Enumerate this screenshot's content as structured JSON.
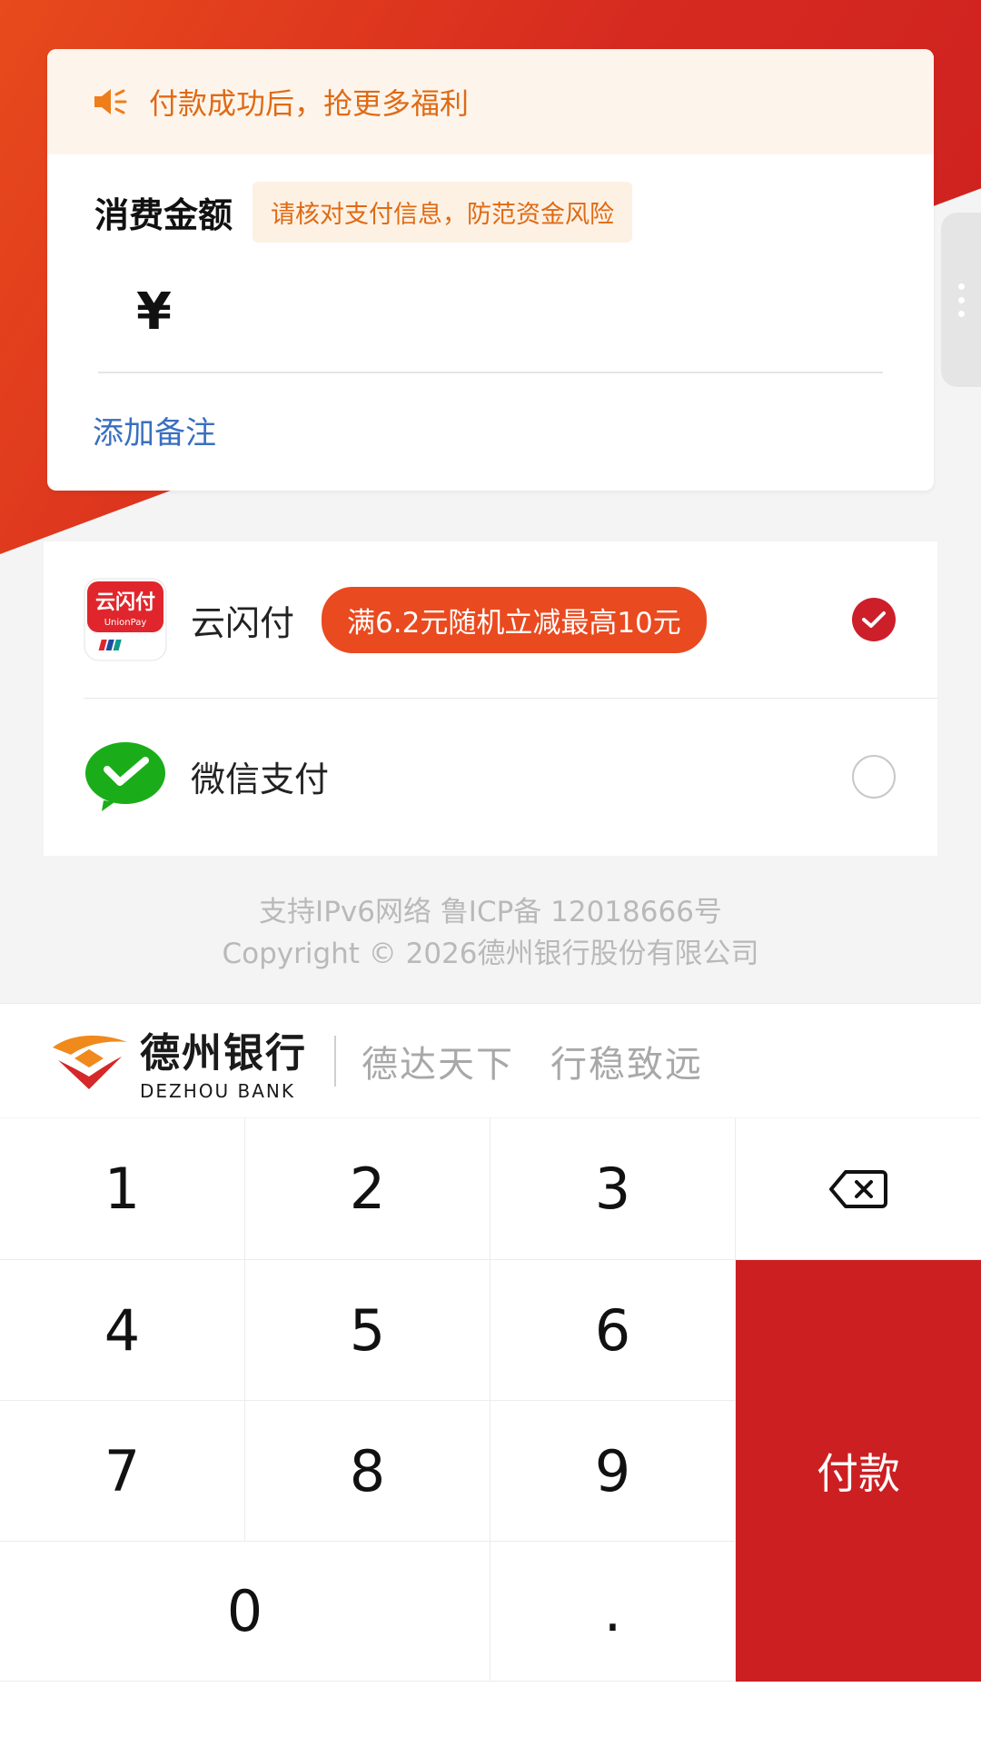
{
  "notice": {
    "text": "付款成功后，抢更多福利",
    "icon": "speaker-icon"
  },
  "amount": {
    "title": "消费金额",
    "tip": "请核对支付信息，防范资金风险",
    "currency": "¥",
    "value": "",
    "add_note": "添加备注"
  },
  "payment_methods": [
    {
      "name": "云闪付",
      "icon": "unionpay-icon",
      "icon_text": "云闪付",
      "icon_sub": "UnionPay",
      "promo": "满6.2元随机立减最高10元",
      "selected": true
    },
    {
      "name": "微信支付",
      "icon": "wechat-pay-icon",
      "selected": false
    }
  ],
  "footer": {
    "line1": "支持IPv6网络 鲁ICP备 12018666号",
    "line2": "Copyright © 2026德州银行股份有限公司"
  },
  "brand": {
    "name_cn": "德州银行",
    "name_en": "DEZHOU BANK",
    "slogan1": "德达天下",
    "slogan2": "行稳致远"
  },
  "keypad": {
    "keys": [
      "1",
      "2",
      "3",
      "4",
      "5",
      "6",
      "7",
      "8",
      "9",
      "0",
      "."
    ],
    "backspace_icon": "backspace-icon",
    "pay_label": "付款"
  },
  "colors": {
    "brand_red": "#cc1f22",
    "promo_orange": "#ea4a1f",
    "notice_orange": "#e06a14",
    "link_blue": "#3a6fbf"
  }
}
